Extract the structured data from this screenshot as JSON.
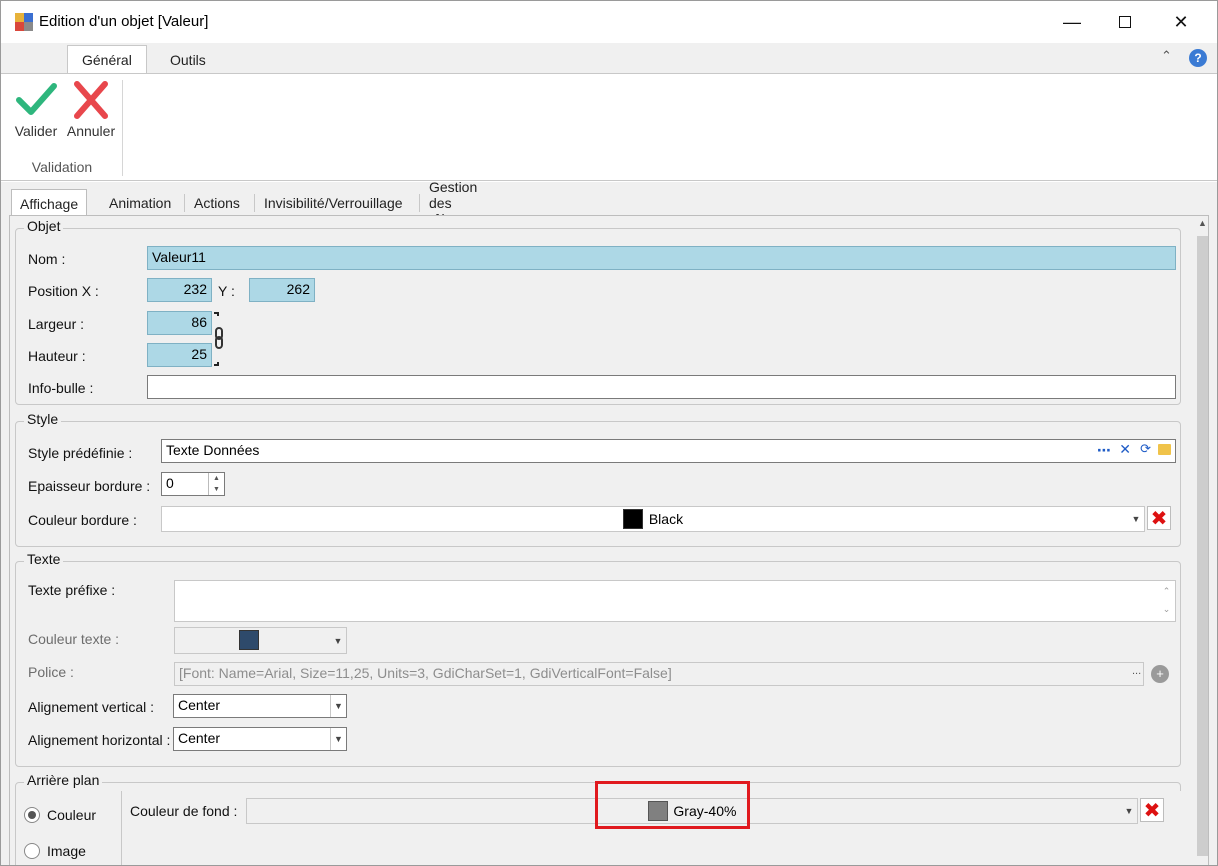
{
  "window": {
    "title": "Edition d'un objet [Valeur]",
    "min_icon": "minimize-icon",
    "max_icon": "maximize-icon",
    "close_icon": "close-icon"
  },
  "ribbon": {
    "tabs": [
      "Général",
      "Outils"
    ],
    "active_tab": "Général",
    "buttons": [
      {
        "label": "Valider",
        "icon": "checkmark-icon",
        "color": "#2eb67d"
      },
      {
        "label": "Annuler",
        "icon": "cross-icon",
        "color": "#e8474c"
      }
    ],
    "group_label": "Validation"
  },
  "tabs": [
    "Affichage",
    "Animation",
    "Actions",
    "Invisibilité/Verrouillage",
    "Gestion des rôles"
  ],
  "active_tab": "Affichage",
  "objet": {
    "legend": "Objet",
    "nom_label": "Nom :",
    "nom_value": "Valeur11",
    "posx_label": "Position X :",
    "posx_value": "232",
    "y_label": "Y :",
    "y_value": "262",
    "largeur_label": "Largeur :",
    "largeur_value": "86",
    "hauteur_label": "Hauteur :",
    "hauteur_value": "25",
    "infobulle_label": "Info-bulle :",
    "infobulle_value": ""
  },
  "style": {
    "legend": "Style",
    "predef_label": "Style prédéfinie :",
    "predef_value": "Texte Données",
    "epaisseur_label": "Epaisseur bordure :",
    "epaisseur_value": "0",
    "couleur_label": "Couleur bordure :",
    "couleur_value": "Black",
    "couleur_hex": "#000000"
  },
  "texte": {
    "legend": "Texte",
    "prefixe_label": "Texte préfixe :",
    "prefixe_value": "",
    "couleur_label": "Couleur texte :",
    "couleur_hex": "#2e4a6b",
    "police_label": "Police :",
    "police_value": "[Font: Name=Arial, Size=11,25, Units=3, GdiCharSet=1, GdiVerticalFont=False]",
    "valign_label": "Alignement vertical :",
    "valign_value": "Center",
    "halign_label": "Alignement horizontal :",
    "halign_value": "Center"
  },
  "arriere": {
    "legend": "Arrière plan",
    "radio_couleur": "Couleur",
    "radio_image": "Image",
    "fond_label": "Couleur de fond :",
    "fond_value": "Gray-40%",
    "fond_hex": "#808080"
  }
}
